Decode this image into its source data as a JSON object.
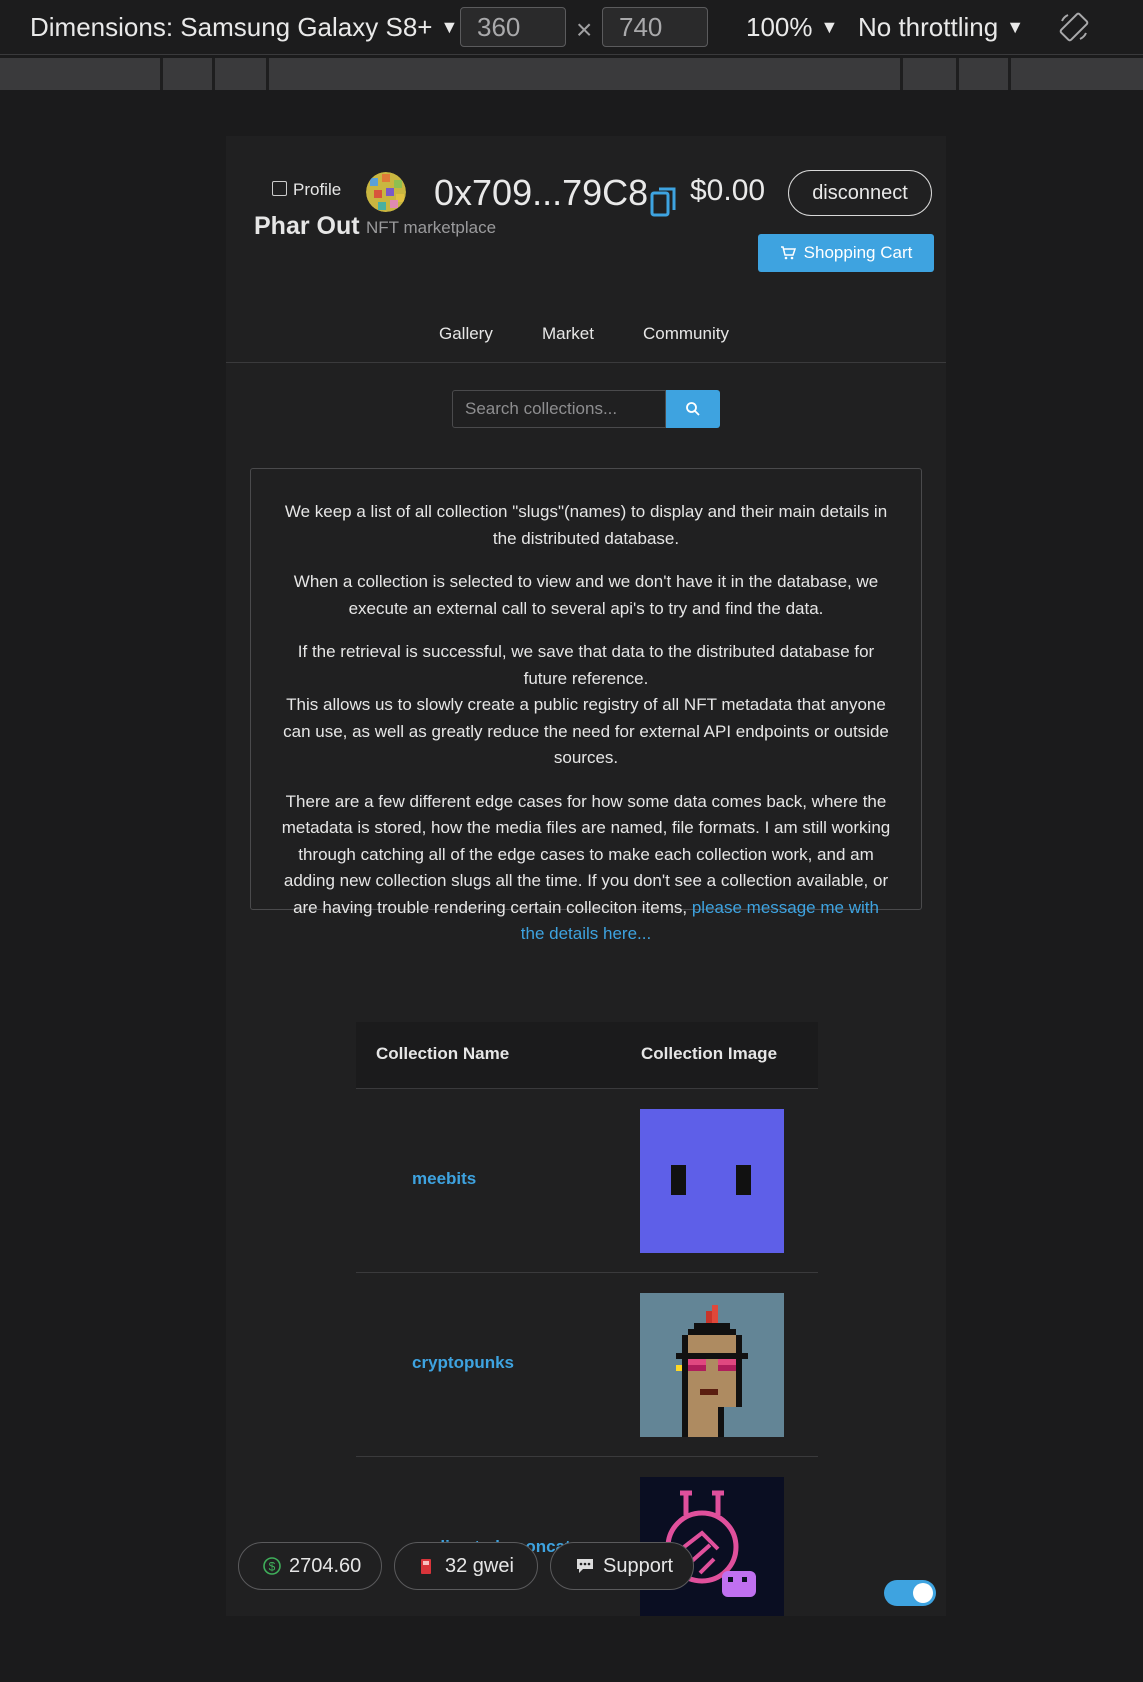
{
  "devtools": {
    "device_label": "Dimensions: Samsung Galaxy S8+",
    "width_value": "360",
    "times": "×",
    "height_value": "740",
    "zoom": "100%",
    "throttling": "No throttling"
  },
  "header": {
    "profile_label": "Profile",
    "brand": "Phar Out",
    "subtitle": "NFT marketplace",
    "address": "0x709...79C8",
    "balance": "$0.00",
    "disconnect_label": "disconnect",
    "cart_label": "Shopping Cart"
  },
  "nav": {
    "tabs": [
      {
        "label": "Gallery"
      },
      {
        "label": "Market"
      },
      {
        "label": "Community"
      }
    ]
  },
  "search": {
    "placeholder": "Search collections..."
  },
  "info": {
    "p1": "We keep a list of all collection \"slugs\"(names) to display and their main details in the distributed database.",
    "p2": "When a collection is selected to view and we don't have it in the database, we execute an external call to several api's to try and find the data.",
    "p3a": "If the retrieval is successful, we save that data to the distributed database for future reference.",
    "p3b": "This allows us to slowly create a public registry of all NFT metadata that anyone can use, as well as greatly reduce the need for external API endpoints or outside sources.",
    "p4": "There are a few different edge cases for how some data comes back, where the metadata is stored, how the media files are named, file formats. I am still working through catching all of the edge cases to make each collection work, and am adding new collection slugs all the time. If you don't see a collection available, or are having trouble rendering certain colleciton items,",
    "link": "please message me with the details here..."
  },
  "table": {
    "headers": [
      "Collection Name",
      "Collection Image"
    ],
    "rows": [
      {
        "name": "meebits"
      },
      {
        "name": "cryptopunks"
      },
      {
        "name": "acclimatedmooncats"
      }
    ]
  },
  "footer": {
    "eth_price": "2704.60",
    "gas": "32 gwei",
    "support_label": "Support"
  },
  "theme": {
    "accent": "#3ea3e0",
    "background": "#1b1b1c",
    "card": "#202021"
  }
}
